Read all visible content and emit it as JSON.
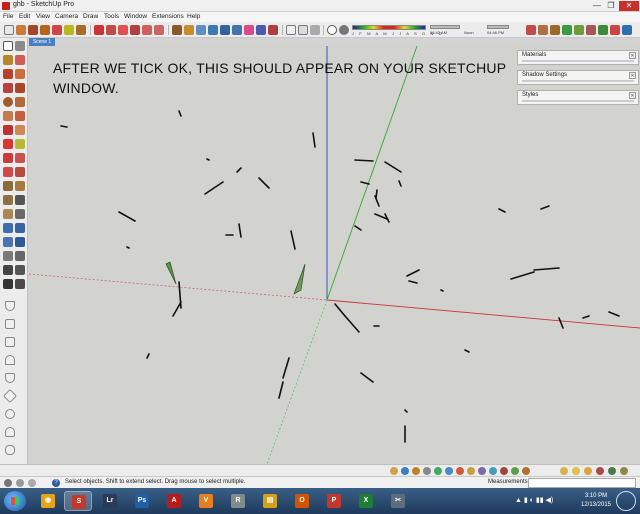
{
  "window": {
    "title": "ghb - SketchUp Pro",
    "minimize": "—",
    "maximize": "❐",
    "close": "✕"
  },
  "menu": [
    "File",
    "Edit",
    "View",
    "Camera",
    "Draw",
    "Tools",
    "Window",
    "Extensions",
    "Help"
  ],
  "toolbar": {
    "months": "J F M A M J J A S O N D",
    "time_left": "06:42 AM",
    "noon": "Noon",
    "time_right": "04:46 PM"
  },
  "scene": {
    "tab_label": "Scene 1"
  },
  "viewport": {
    "instruction": "AFTER WE TICK OK, THIS SHOULD APPEAR ON YOUR SKETCHUP WINDOW."
  },
  "tray": {
    "panels": [
      {
        "label": "Materials"
      },
      {
        "label": "Shadow Settings"
      },
      {
        "label": "Styles"
      }
    ]
  },
  "status": {
    "message": "Select objects. Shift to extend select. Drag mouse to select multiple.",
    "measurements_label": "Measurements",
    "help_glyph": "?"
  },
  "taskbar": {
    "apps": [
      {
        "name": "chrome",
        "glyph": "◉",
        "color": "#e8a317"
      },
      {
        "name": "sketchup",
        "glyph": "S",
        "color": "#c0392b"
      },
      {
        "name": "lightroom",
        "glyph": "Lr",
        "color": "#2b3a55"
      },
      {
        "name": "photoshop",
        "glyph": "Ps",
        "color": "#1e5fa8"
      },
      {
        "name": "autocad",
        "glyph": "A",
        "color": "#b71c1c"
      },
      {
        "name": "vectorworks",
        "glyph": "V",
        "color": "#e67e22"
      },
      {
        "name": "rhino",
        "glyph": "R",
        "color": "#7f8c8d"
      },
      {
        "name": "explorer",
        "glyph": "▤",
        "color": "#d4a017"
      },
      {
        "name": "outlook",
        "glyph": "O",
        "color": "#d35400"
      },
      {
        "name": "powerpoint",
        "glyph": "P",
        "color": "#c0392b"
      },
      {
        "name": "excel",
        "glyph": "X",
        "color": "#1e7e34"
      },
      {
        "name": "snipping-tool",
        "glyph": "✂",
        "color": "#5d6d7e"
      }
    ],
    "clock_time": "3:10 PM",
    "clock_date": "12/13/2015"
  },
  "colors": {
    "red_axis": "#cc3333",
    "green_axis": "#33aa33",
    "blue_axis": "#3355bb",
    "viewport_bg": "#d2d2cf"
  }
}
